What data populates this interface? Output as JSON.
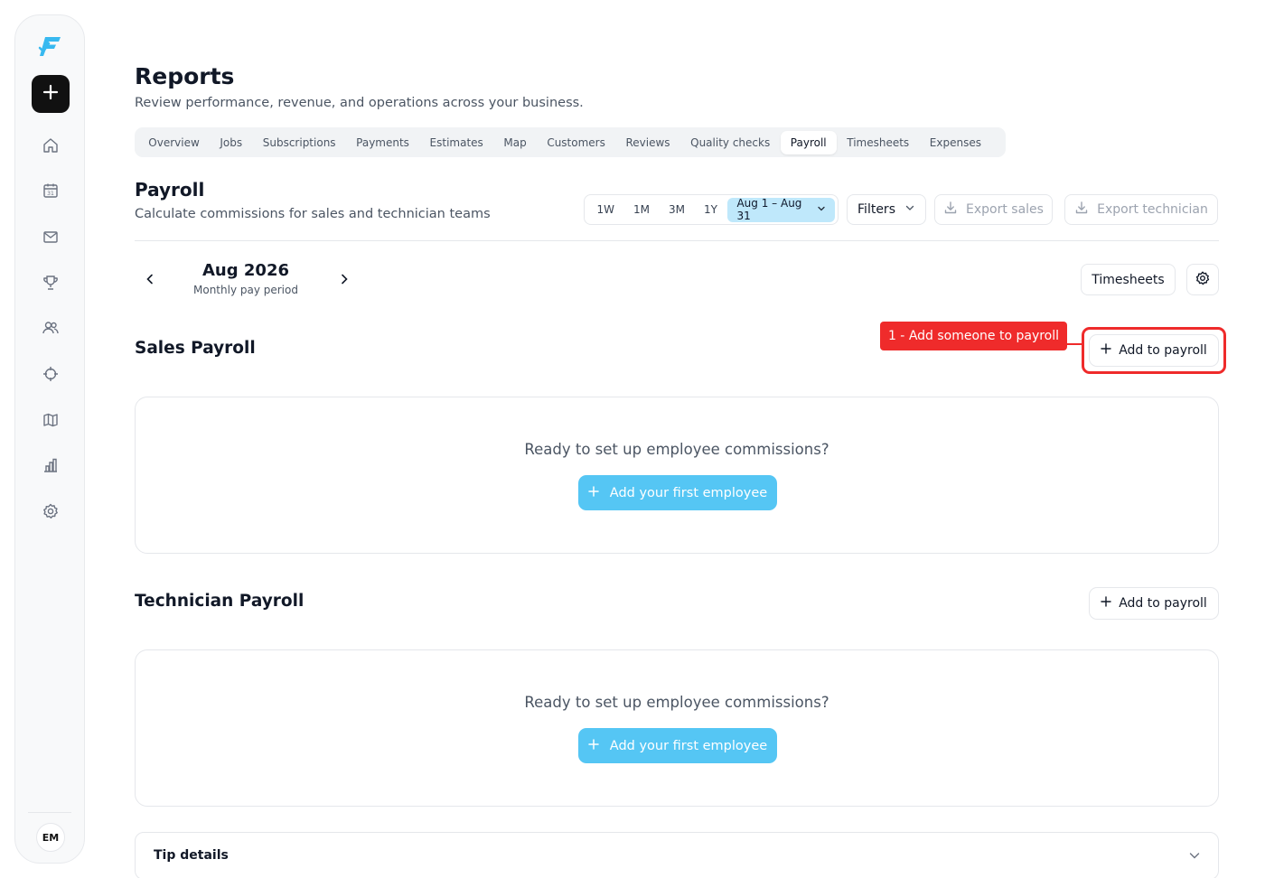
{
  "sidebar": {
    "logo_icon": "app-logo",
    "create_icon": "plus-icon",
    "nav_items": [
      {
        "icon": "home-icon"
      },
      {
        "icon": "calendar-icon",
        "text": "31"
      },
      {
        "icon": "mail-icon"
      },
      {
        "icon": "trophy-icon"
      },
      {
        "icon": "users-icon"
      },
      {
        "icon": "target-icon"
      },
      {
        "icon": "map-icon"
      },
      {
        "icon": "bar-chart-icon"
      },
      {
        "icon": "settings-icon"
      }
    ],
    "avatar_initials": "EM"
  },
  "header": {
    "title": "Reports",
    "subtitle": "Review performance, revenue, and operations across your business."
  },
  "tabs": [
    {
      "label": "Overview"
    },
    {
      "label": "Jobs"
    },
    {
      "label": "Subscriptions"
    },
    {
      "label": "Payments"
    },
    {
      "label": "Estimates"
    },
    {
      "label": "Map"
    },
    {
      "label": "Customers"
    },
    {
      "label": "Reviews"
    },
    {
      "label": "Quality checks"
    },
    {
      "label": "Payroll",
      "active": true
    },
    {
      "label": "Timesheets"
    },
    {
      "label": "Expenses"
    }
  ],
  "section": {
    "title": "Payroll",
    "subtitle": "Calculate commissions for sales and technician teams"
  },
  "range": {
    "options": [
      "1W",
      "1M",
      "3M",
      "1Y"
    ],
    "selected_date": "Aug 1 – Aug 31"
  },
  "toolbar": {
    "filters_label": "Filters",
    "export_sales_label": "Export sales",
    "export_technician_label": "Export technician"
  },
  "period": {
    "month": "Aug 2026",
    "label": "Monthly pay period",
    "timesheets_label": "Timesheets"
  },
  "annotation": {
    "callout": "1 - Add someone to payroll",
    "color": "#ef2b2b"
  },
  "sales": {
    "title": "Sales Payroll",
    "add_label": "Add to payroll",
    "empty_text": "Ready to set up employee commissions?",
    "first_employee_label": "Add your first employee"
  },
  "technician": {
    "title": "Technician Payroll",
    "add_label": "Add to payroll",
    "empty_text": "Ready to set up employee commissions?",
    "first_employee_label": "Add your first employee"
  },
  "tips": {
    "label": "Tip details"
  },
  "colors": {
    "accent": "#55c6f4",
    "selected_range": "#bfe8fb",
    "primary_dark": "#111111"
  }
}
